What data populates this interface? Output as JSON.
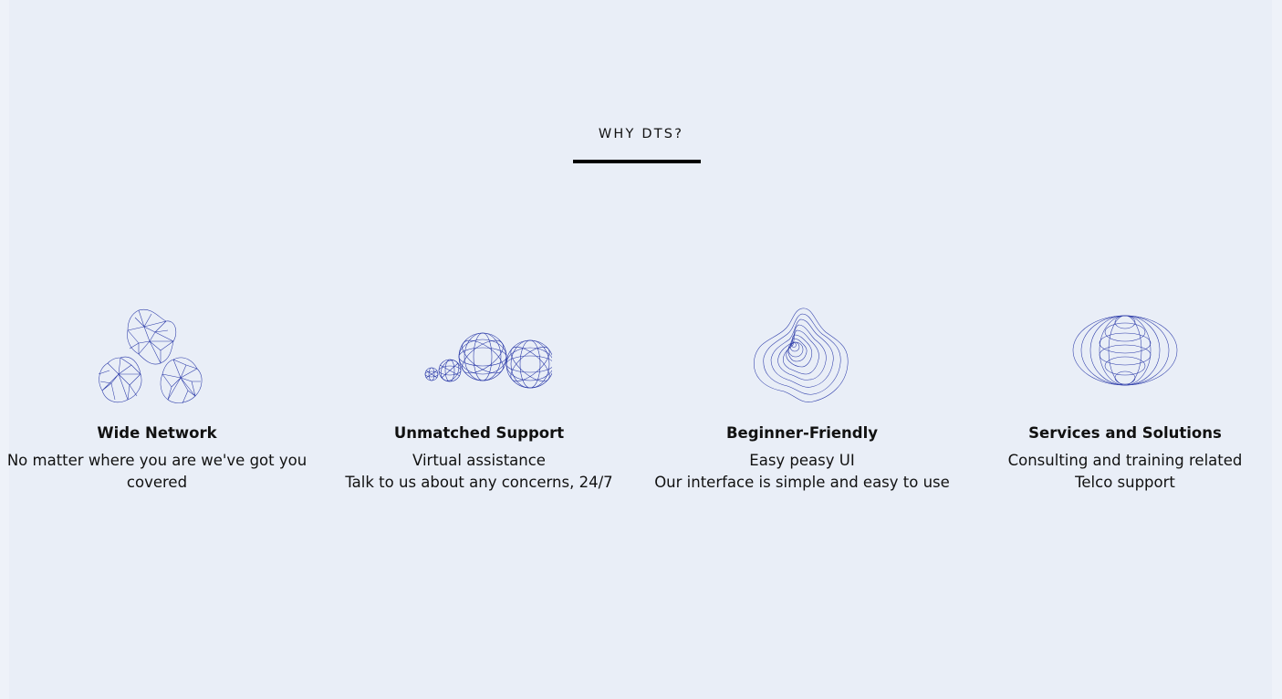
{
  "section": {
    "title": "WHY DTS?"
  },
  "features": [
    {
      "icon": "wireframe-blobs-icon",
      "title": "Wide Network",
      "lines": [
        "No matter where you are we've got you covered"
      ]
    },
    {
      "icon": "wireframe-spheres-icon",
      "title": "Unmatched Support",
      "lines": [
        "Virtual assistance",
        "Talk to us about any concerns, 24/7"
      ]
    },
    {
      "icon": "contour-rings-icon",
      "title": "Beginner-Friendly",
      "lines": [
        "Easy peasy UI",
        "Our interface is simple and easy to use"
      ]
    },
    {
      "icon": "ellipsoid-rings-icon",
      "title": "Services and Solutions",
      "lines": [
        "Consulting and training related",
        "Telco support"
      ]
    }
  ],
  "colors": {
    "background": "#e9eef7",
    "line_art": "#2b3aa8",
    "text": "#111111",
    "underline": "#000000"
  }
}
